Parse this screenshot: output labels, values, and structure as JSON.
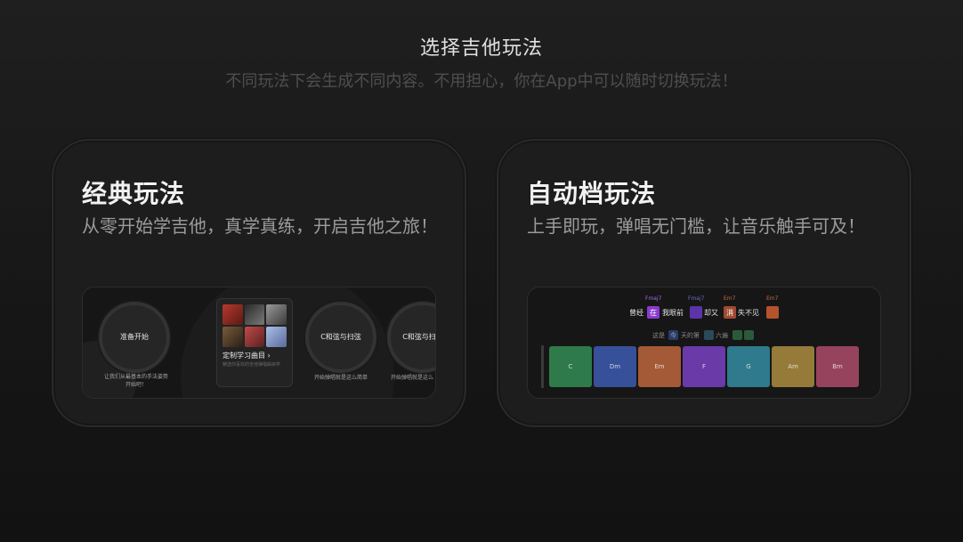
{
  "header": {
    "title": "选择吉他玩法",
    "subtitle": "不同玩法下会生成不同内容。不用担心，你在App中可以随时切换玩法！"
  },
  "cards": {
    "classic": {
      "title": "经典玩法",
      "desc": "从零开始学吉他，真学真练，开启吉他之旅！",
      "preview": {
        "circle1": "准备开始",
        "circle1_caption": "让我们从最基本的手法姿势开始吧！",
        "album_title": "定制学习曲目",
        "album_sub": "精选你喜欢的吉他弹唱曲目学",
        "circle2": "C和弦与扫弦",
        "circle2_caption": "开始弹唱就是这么简单",
        "circle3": "C和弦与扫弦",
        "circle3_caption": "开始弹唱就是这么",
        "album_colors": [
          "#8a2b22",
          "#4a4a4a",
          "#6e6e6e",
          "#5a4a3a",
          "#8a3a3a",
          "#7a8aa8"
        ]
      }
    },
    "auto": {
      "title": "自动档玩法",
      "desc": "上手即玩，弹唱无门槛，让音乐触手可及！",
      "preview": {
        "chord_labels": [
          "Fmaj7",
          "Fmaj7",
          "Em7",
          "Em7"
        ],
        "lyric_line1": {
          "w1": "曾经",
          "box1": "在",
          "w2": "我眼前",
          "w3": "却又",
          "box3": "消",
          "w4": "失不见"
        },
        "lyric_line2": {
          "w1": "这是",
          "box1": "今",
          "w2": "天的第",
          "w3": "六遍"
        },
        "pads": [
          {
            "label": "C",
            "color": "#2f7a4a"
          },
          {
            "label": "Dm",
            "color": "#37509a"
          },
          {
            "label": "Em",
            "color": "#a45a36"
          },
          {
            "label": "F",
            "color": "#6a3aa8"
          },
          {
            "label": "G",
            "color": "#2f7a8c"
          },
          {
            "label": "Am",
            "color": "#957a3a"
          },
          {
            "label": "Bm",
            "color": "#96435e"
          }
        ]
      }
    }
  }
}
